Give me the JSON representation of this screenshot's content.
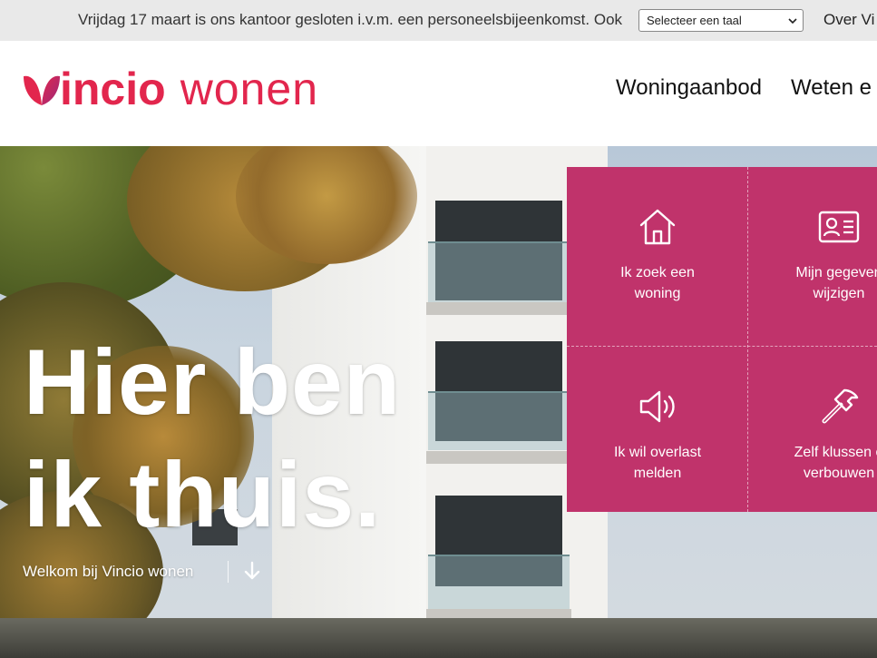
{
  "topbar": {
    "announcement": "Vrijdag 17 maart is ons kantoor gesloten i.v.m. een personeelsbijeenkomst. Ook",
    "language_select": "Selecteer een taal",
    "over_link": "Over Vi"
  },
  "header": {
    "logo_word1": "incio",
    "logo_word2": "wonen",
    "nav": [
      {
        "label": "Woningaanbod"
      },
      {
        "label": "Weten e"
      }
    ]
  },
  "hero": {
    "title_line1": "Hier ben",
    "title_line2": "ik thuis.",
    "welcome": "Welkom bij Vincio wonen"
  },
  "tiles": [
    {
      "label_line1": "Ik zoek een",
      "label_line2": "woning",
      "icon": "house-icon"
    },
    {
      "label_line1": "Mijn gegeven",
      "label_line2": "wijzigen",
      "icon": "id-card-icon"
    },
    {
      "label_line1": "Ik wil overlast",
      "label_line2": "melden",
      "icon": "megaphone-icon"
    },
    {
      "label_line1": "Zelf klussen o",
      "label_line2": "verbouwen",
      "icon": "hammer-icon"
    }
  ],
  "colors": {
    "brand": "#e2264d",
    "tile_bg": "#c0336b",
    "topbar_bg": "#e9e9e9"
  }
}
